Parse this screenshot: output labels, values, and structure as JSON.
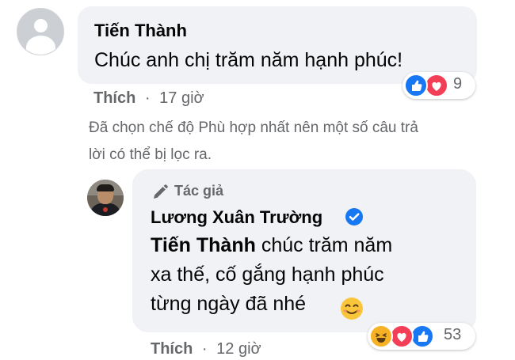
{
  "comment1": {
    "author": "Tiến Thành",
    "text": "Chúc anh chị trăm năm hạnh phúc!",
    "reactions": {
      "icons": [
        "like-icon",
        "love-icon"
      ],
      "count": "9"
    },
    "action_like": "Thích",
    "separator": "·",
    "time": "17 giờ"
  },
  "filter_notice": {
    "line1": "Đã chọn chế độ Phù hợp nhất nên một số câu trả",
    "line2": "lời có thể bị lọc ra."
  },
  "reply": {
    "author_tag": "Tác giả",
    "author": "Lương Xuân Trường",
    "verified": true,
    "mention": "Tiến Thành",
    "text_line1": " chúc trăm năm",
    "text_line2": "xa thế, cố gắng hạnh phúc",
    "text_line3": "từng ngày đã nhé",
    "emoji": "smiling-face-icon",
    "reactions": {
      "icons": [
        "haha-icon",
        "love-icon",
        "like-icon"
      ],
      "count": "53"
    },
    "action_like": "Thích",
    "separator": "·",
    "time": "12 giờ"
  },
  "colors": {
    "bubble": "#f0f2f5",
    "secondary_text": "#65676b",
    "like_blue": "#1877f2",
    "love_red": "#f33e58",
    "haha_yellow": "#f7b125",
    "verified_blue": "#1877f2"
  }
}
